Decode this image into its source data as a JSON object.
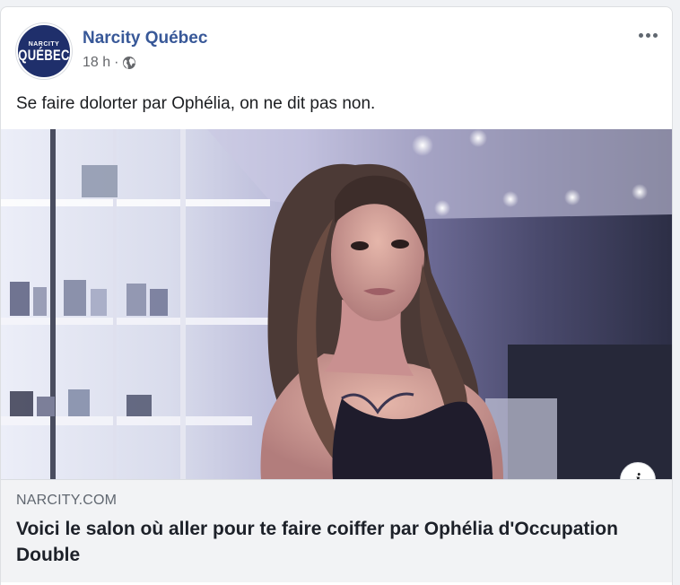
{
  "post": {
    "page_name": "Narcity Québec",
    "avatar_text_top": "NARCITY",
    "avatar_text_bottom": "QUÉBEC",
    "timestamp": "18 h",
    "separator": "·",
    "privacy_icon": "globe-icon",
    "more_icon": "more-options-icon",
    "text": "Se faire dolorter par Ophélia, on ne dit pas non."
  },
  "link_preview": {
    "info_glyph": "i",
    "domain": "NARCITY.COM",
    "title": "Voici le salon où aller pour te faire coiffer par Ophélia d'Occupation Double"
  },
  "colors": {
    "page_name": "#385898",
    "avatar_bg": "#1f2f6b",
    "link_box_bg": "#f2f3f5",
    "meta_text": "#65676b"
  }
}
